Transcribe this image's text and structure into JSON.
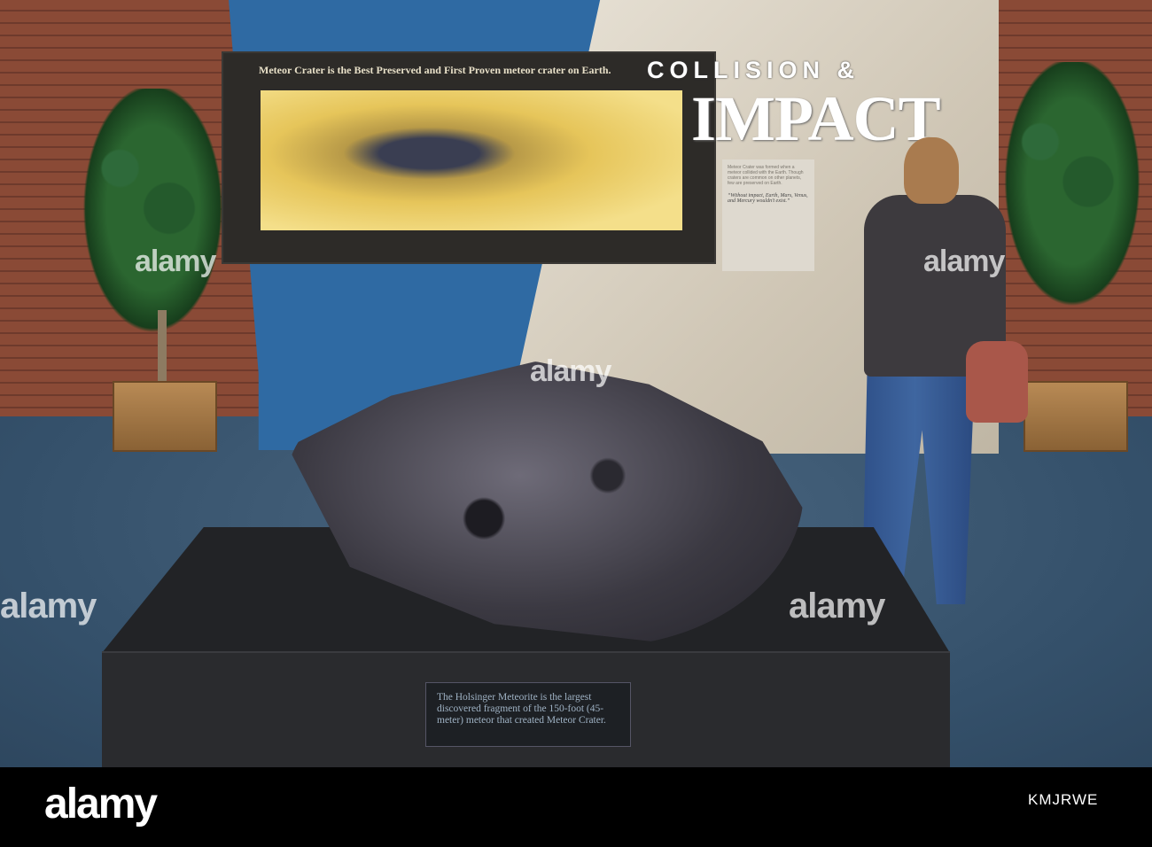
{
  "exhibit": {
    "screen_caption": "Meteor Crater is the Best Preserved and First Proven meteor crater on Earth.",
    "title_line1": "COLLISION &",
    "title_line2": "IMPACT",
    "text_card_body": "Meteor Crater was formed when a meteor collided with the Earth. Though craters are common on other planets, few are preserved on Earth.",
    "text_card_quote": "“Without impact, Earth, Mars, Venus, and Mercury wouldn't exist.”",
    "plaque_text": "The Holsinger Meteorite is the largest discovered fragment of the 150-foot (45-meter) meteor that created Meteor Crater."
  },
  "watermark": {
    "text": "alamy",
    "logo": "alamy",
    "image_id": "KMJRWE"
  }
}
